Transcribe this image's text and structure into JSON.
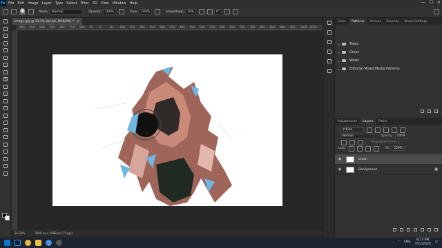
{
  "app": {
    "logo": "Ps"
  },
  "menu": [
    "File",
    "Edit",
    "Image",
    "Layer",
    "Type",
    "Select",
    "Filter",
    "3D",
    "View",
    "Window",
    "Help"
  ],
  "window_controls": [
    "—",
    "☐",
    "✕"
  ],
  "options": {
    "brush_size": "268",
    "mode_label": "Mode:",
    "mode_value": "Normal",
    "opacity_label": "Opacity:",
    "opacity_value": "100%",
    "flow_label": "Flow:",
    "flow_value": "100%",
    "smoothing_label": "Smoothing:",
    "smoothing_value": "10%",
    "angle_value": "0°"
  },
  "document": {
    "tab_title": "image.jpg @ 33.3% (brush, RGB/8#) *",
    "close": "×"
  },
  "ruler_ticks": [
    "400",
    "350",
    "300",
    "250",
    "200",
    "150",
    "100",
    "50",
    "0",
    "50",
    "100",
    "150",
    "200",
    "250",
    "300",
    "350",
    "400",
    "450",
    "500",
    "550",
    "600",
    "650",
    "700",
    "750",
    "800",
    "850",
    "900",
    "950",
    "1000",
    "1050"
  ],
  "status": {
    "zoom": "33.33%",
    "doc_info": "3000 px x 1688 px (72 ppi)"
  },
  "panels": {
    "top_tabs": [
      "Color",
      "Patterns",
      "Actions",
      "Brushes",
      "Brush Settings"
    ],
    "active_top": "Patterns",
    "pattern_groups": [
      "Trees",
      "Grass",
      "Water",
      "Editorial Mixed Media Patterns"
    ],
    "layer_tabs": [
      "Adjustments",
      "Layers",
      "Paths"
    ],
    "active_layer_tab": "Layers",
    "kind_label": "Kind",
    "blend_value": "Normal",
    "opacity_label": "Opacity:",
    "opacity_value": "100%",
    "propagate_label": "Propagate Frame 1",
    "lock_label": "Lock:",
    "fill_label": "Fill:",
    "fill_value": "100%",
    "layers": [
      {
        "name": "brush",
        "selected": true
      },
      {
        "name": "Background",
        "selected": false
      }
    ]
  },
  "taskbar": {
    "language": "ENG",
    "time": "8:13 PM",
    "date": "7/22/2020"
  },
  "colors": {
    "accent": "#31a8ff",
    "panel": "#323232",
    "canvas_bg": "#ffffff"
  }
}
